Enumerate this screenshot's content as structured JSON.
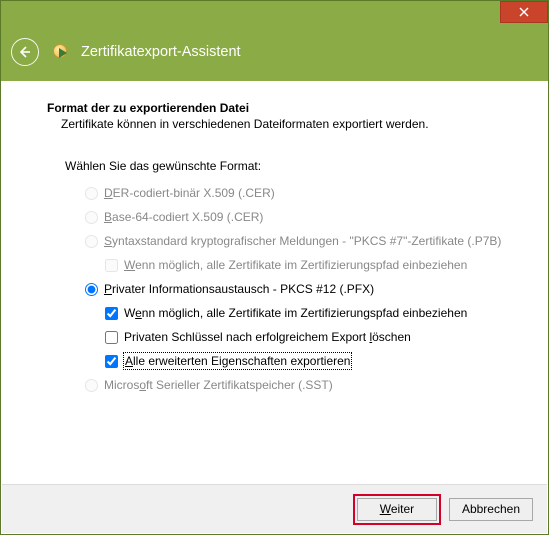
{
  "window": {
    "title": "Zertifikatexport-Assistent"
  },
  "page": {
    "heading": "Format der zu exportierenden Datei",
    "subheading": "Zertifikate können in verschiedenen Dateiformaten exportiert werden.",
    "prompt": "Wählen Sie das gewünschte Format:"
  },
  "opts": {
    "der": {
      "pre": "",
      "u": "D",
      "post": "ER-codiert-binär X.509 (.CER)"
    },
    "b64": {
      "pre": "",
      "u": "B",
      "post": "ase-64-codiert X.509 (.CER)"
    },
    "p7b": {
      "pre": "",
      "u": "S",
      "post": "yntaxstandard kryptografischer Meldungen - \"PKCS #7\"-Zertifikate (.P7B)"
    },
    "p7b_chain": {
      "pre": "",
      "u": "W",
      "post": "enn möglich, alle Zertifikate im Zertifizierungspfad einbeziehen"
    },
    "pfx": {
      "pre": "",
      "u": "P",
      "post": "rivater Informationsaustausch - PKCS #12 (.PFX)"
    },
    "pfx_chain": {
      "pre": "W",
      "u": "e",
      "post": "nn möglich, alle Zertifikate im Zertifizierungspfad einbeziehen"
    },
    "pfx_delete": {
      "pre": "Privaten Schlüssel nach erfolgreichem Export ",
      "u": "l",
      "post": "öschen"
    },
    "pfx_ext": {
      "pre": "",
      "u": "A",
      "post": "lle erweiterten Eigenschaften exportieren"
    },
    "sst": {
      "pre": "Micros",
      "u": "o",
      "post": "ft Serieller Zertifikatspeicher (.SST)"
    }
  },
  "buttons": {
    "next": {
      "pre": "",
      "u": "W",
      "post": "eiter"
    },
    "cancel": {
      "label": "Abbrechen"
    }
  }
}
